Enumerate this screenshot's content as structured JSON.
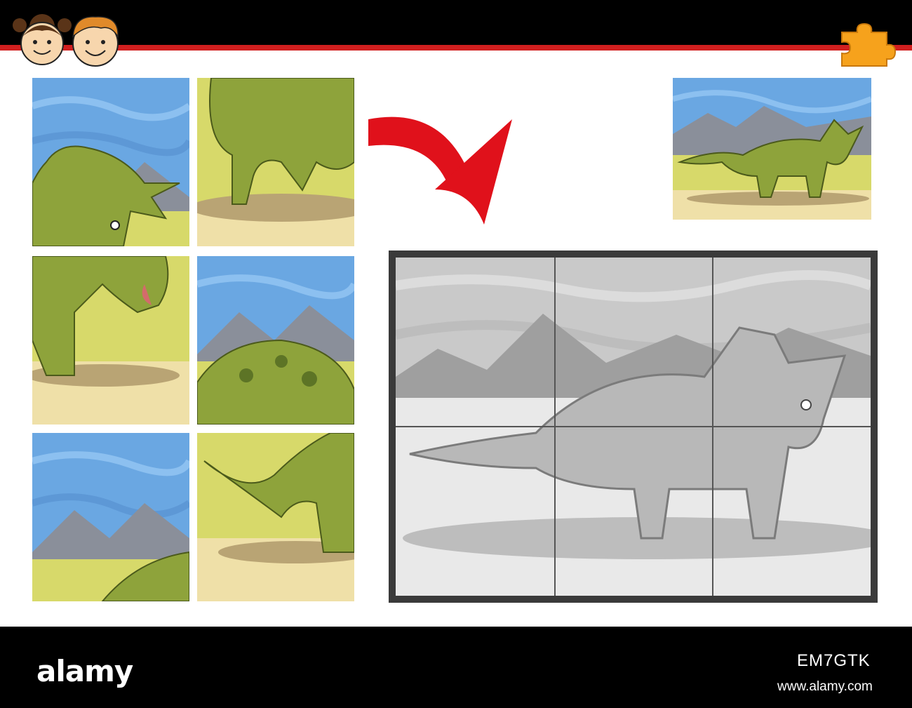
{
  "header": {
    "kids_icon": "two-kids-faces-icon",
    "puzzle_icon": "puzzle-piece-icon",
    "accent_red": "#d11f1f",
    "bar_color": "#000000"
  },
  "game": {
    "arrow_icon": "curved-arrow-icon",
    "arrow_color": "#e0111b",
    "tiles_icon": "jigsaw-tile-icon",
    "board_grid": {
      "columns": 3,
      "rows": 2
    },
    "pieces_count_loose": 6
  },
  "footer": {
    "brand": "alamy",
    "image_id": "EM7GTK",
    "url": "www.alamy.com"
  }
}
